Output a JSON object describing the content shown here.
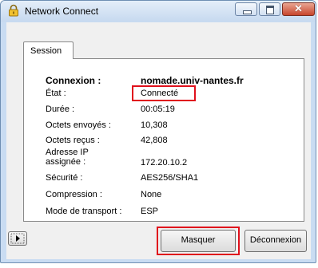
{
  "window": {
    "title": "Network Connect",
    "close_glyph": "✕"
  },
  "tab": {
    "label": "Session"
  },
  "rows": [
    {
      "label": "Connexion :",
      "value": "nomade.univ-nantes.fr"
    },
    {
      "label": "État :",
      "value": "Connecté"
    },
    {
      "label": "Durée :",
      "value": "00:05:19"
    },
    {
      "label": "Octets envoyés :",
      "value": "10,308"
    },
    {
      "label": "Octets reçus :",
      "value": "42,808"
    },
    {
      "label": "Adresse IP assignée :",
      "value": "172.20.10.2"
    },
    {
      "label": "Sécurité :",
      "value": "AES256/SHA1"
    },
    {
      "label": "Compression :",
      "value": "None"
    },
    {
      "label": "Mode de transport :",
      "value": "ESP"
    }
  ],
  "buttons": {
    "hide": "Masquer",
    "disconnect": "Déconnexion"
  },
  "icons": {
    "app": "lock-icon",
    "details": "play-arrow-icon"
  },
  "colors": {
    "highlight": "#e0101c",
    "titlebar": "#c6d9ef",
    "close": "#c7452c"
  }
}
